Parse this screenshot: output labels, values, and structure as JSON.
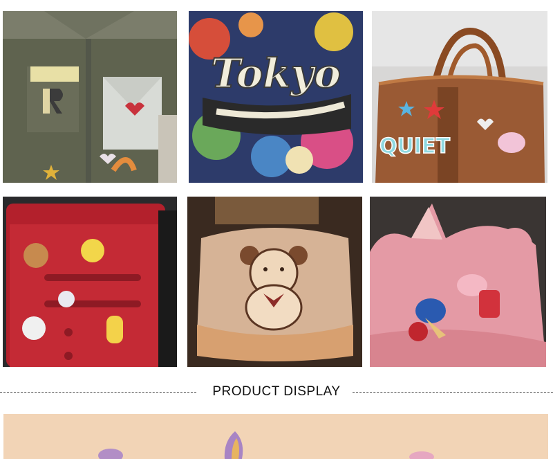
{
  "photos": [
    {
      "subject": "olive shirt with embroidered letter, heart and star patches"
    },
    {
      "subject": "graffiti cap with embroidered script patch",
      "patch_text": "Tokyo"
    },
    {
      "subject": "brown handbag with letter and star patches",
      "patch_text": "QUIET"
    },
    {
      "subject": "red suitcase with cartoon character patches"
    },
    {
      "subject": "fleece sweater with teddy bear patch"
    },
    {
      "subject": "pink straw hat with pig and popsicle patches"
    },
    {
      "subject": "peach felt background with patches (cropped)"
    }
  ],
  "section": {
    "title": "PRODUCT DISPLAY"
  }
}
